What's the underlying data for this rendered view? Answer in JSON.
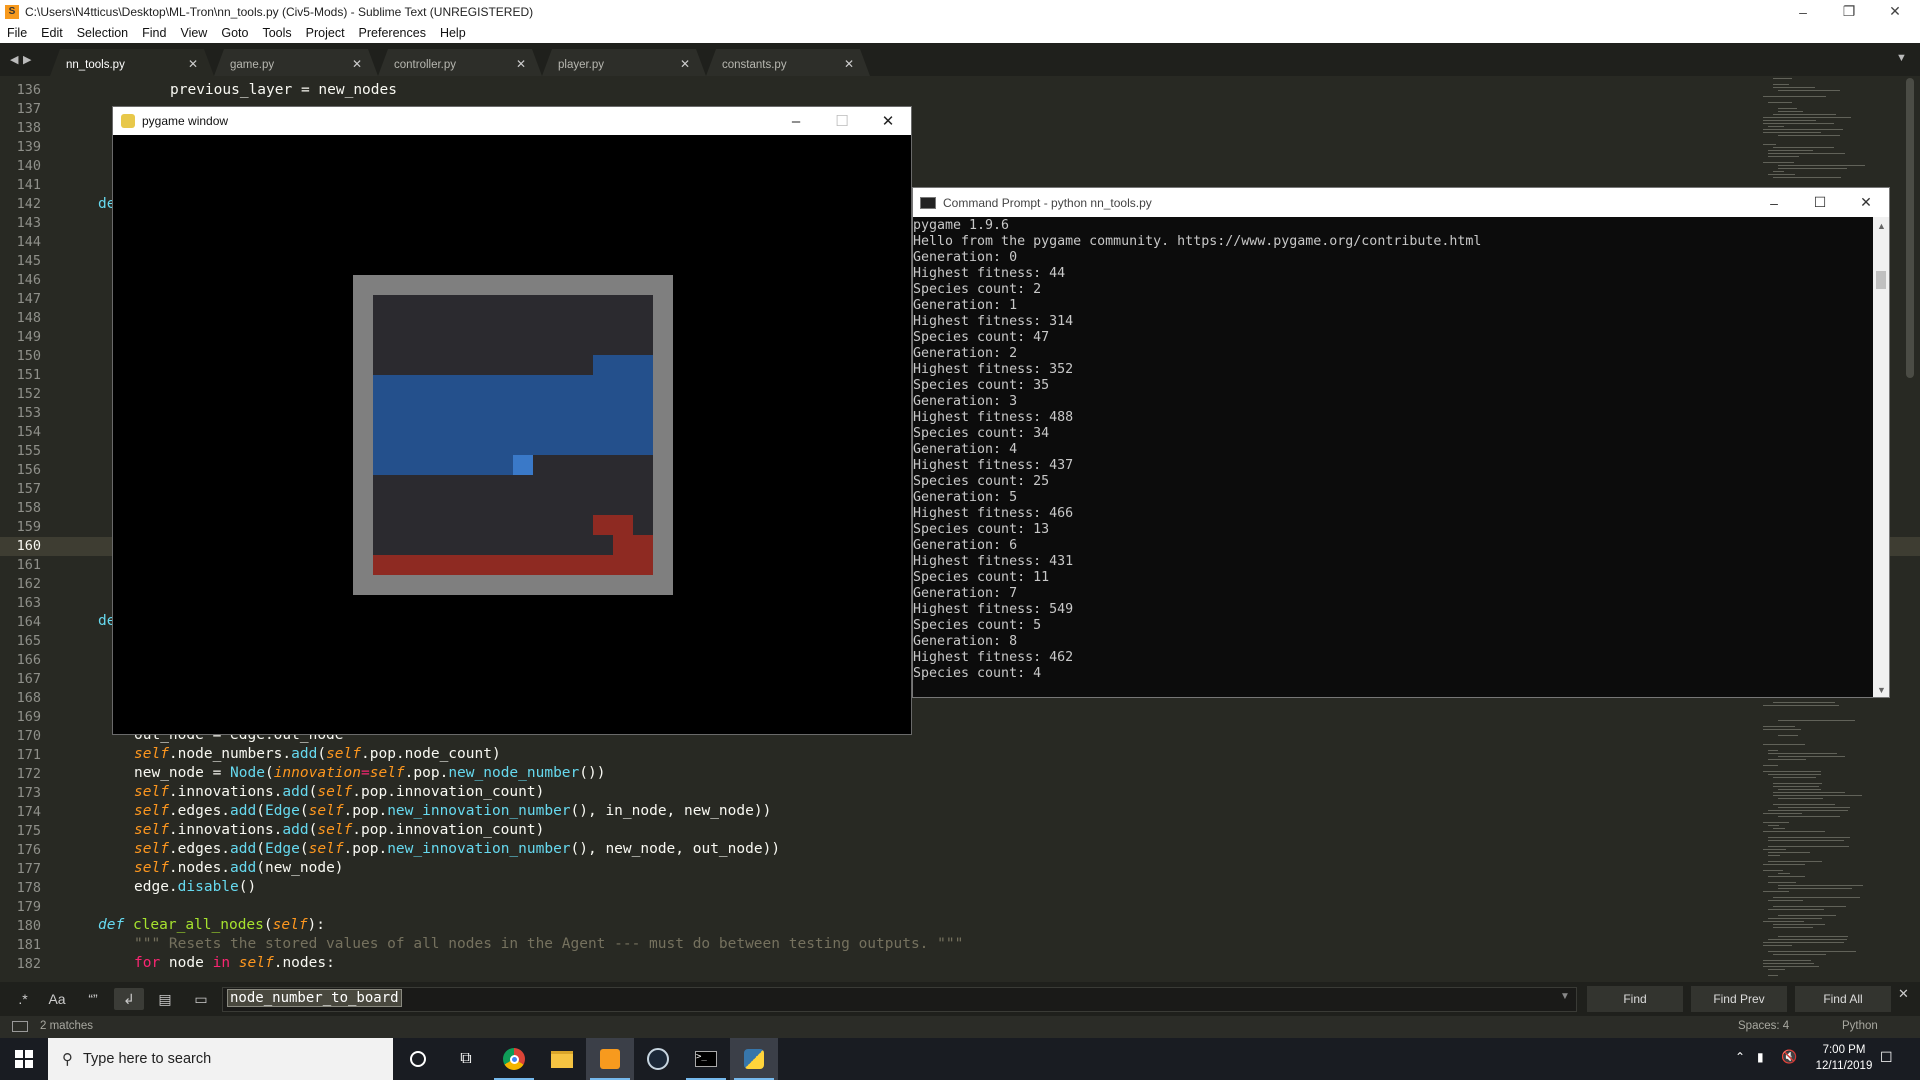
{
  "window": {
    "title": "C:\\Users\\N4tticus\\Desktop\\ML-Tron\\nn_tools.py (Civ5-Mods) - Sublime Text (UNREGISTERED)"
  },
  "menu": [
    "File",
    "Edit",
    "Selection",
    "Find",
    "View",
    "Goto",
    "Tools",
    "Project",
    "Preferences",
    "Help"
  ],
  "tabs": [
    {
      "label": "nn_tools.py",
      "active": true
    },
    {
      "label": "game.py"
    },
    {
      "label": "controller.py"
    },
    {
      "label": "player.py"
    },
    {
      "label": "constants.py"
    }
  ],
  "gutter": [
    "136",
    "137",
    "138",
    "139",
    "140",
    "141",
    "142",
    "143",
    "144",
    "145",
    "146",
    "147",
    "148",
    "149",
    "150",
    "151",
    "152",
    "153",
    "154",
    "155",
    "156",
    "157",
    "158",
    "159",
    "160",
    "161",
    "162",
    "163",
    "164",
    "165",
    "166",
    "167",
    "168",
    "169",
    "170",
    "171",
    "172",
    "173",
    "174",
    "175",
    "176",
    "177",
    "178",
    "179",
    "180",
    "181",
    "182"
  ],
  "current_line": "160",
  "code": {
    "l136": "previous_layer = new_nodes",
    "l142_partial": "de",
    "l164_partial": "de",
    "l170": "out_node = edge.out_node",
    "l171": [
      "self",
      ".node_numbers.",
      "add",
      "(",
      "self",
      ".pop.node_count)"
    ],
    "l172": [
      "new_node = ",
      "Node",
      "(",
      "innovation",
      "=",
      "self",
      ".pop.",
      "new_node_number",
      "())"
    ],
    "l173": [
      "self",
      ".innovations.",
      "add",
      "(",
      "self",
      ".pop.innovation_count)"
    ],
    "l174": [
      "self",
      ".edges.",
      "add",
      "(",
      "Edge",
      "(",
      "self",
      ".pop.",
      "new_innovation_number",
      "(), in_node, new_node))"
    ],
    "l175": [
      "self",
      ".innovations.",
      "add",
      "(",
      "self",
      ".pop.innovation_count)"
    ],
    "l176": [
      "self",
      ".edges.",
      "add",
      "(",
      "Edge",
      "(",
      "self",
      ".pop.",
      "new_innovation_number",
      "(), new_node, out_node))"
    ],
    "l177": [
      "self",
      ".nodes.",
      "add",
      "(new_node)"
    ],
    "l178": [
      "edge.",
      "disable",
      "()"
    ],
    "l180": [
      "def",
      " ",
      "clear_all_nodes",
      "(",
      "self",
      "):"
    ],
    "l181": "\"\"\" Resets the stored values of all nodes in the Agent --- must do between testing outputs. \"\"\"",
    "l182": [
      "for",
      " node ",
      "in",
      " ",
      "self",
      ".nodes:"
    ]
  },
  "find": {
    "value": "node_number_to_board",
    "options": [
      ".*",
      "Aa",
      "“”"
    ],
    "find_label": "Find",
    "find_prev_label": "Find Prev",
    "find_all_label": "Find All"
  },
  "status": {
    "matches": "2 matches",
    "spaces": "Spaces: 4",
    "syntax": "Python"
  },
  "pygame": {
    "title": "pygame window"
  },
  "cmd": {
    "title": "Command Prompt - python  nn_tools.py",
    "lines": [
      "pygame 1.9.6",
      "Hello from the pygame community. https://www.pygame.org/contribute.html",
      "Generation: 0",
      "Highest fitness: 44",
      "Species count: 2",
      "Generation: 1",
      "Highest fitness: 314",
      "Species count: 47",
      "Generation: 2",
      "Highest fitness: 352",
      "Species count: 35",
      "Generation: 3",
      "Highest fitness: 488",
      "Species count: 34",
      "Generation: 4",
      "Highest fitness: 437",
      "Species count: 25",
      "Generation: 5",
      "Highest fitness: 466",
      "Species count: 13",
      "Generation: 6",
      "Highest fitness: 431",
      "Species count: 11",
      "Generation: 7",
      "Highest fitness: 549",
      "Species count: 5",
      "Generation: 8",
      "Highest fitness: 462",
      "Species count: 4"
    ]
  },
  "taskbar": {
    "search_placeholder": "Type here to search",
    "time": "7:00 PM",
    "date": "12/11/2019",
    "apps": [
      "cortana-icon",
      "task-view-icon",
      "chrome-icon",
      "file-explorer-icon",
      "sublime-text-icon",
      "steam-icon",
      "command-prompt-icon",
      "python-icon"
    ]
  },
  "colors": {
    "editor_bg": "#282923",
    "board_border": "#7f7f7f",
    "board_bg": "#2b2a2f",
    "blue_trail": "#24508c",
    "blue_head": "#3a79c8",
    "red_trail": "#8e2a22"
  }
}
